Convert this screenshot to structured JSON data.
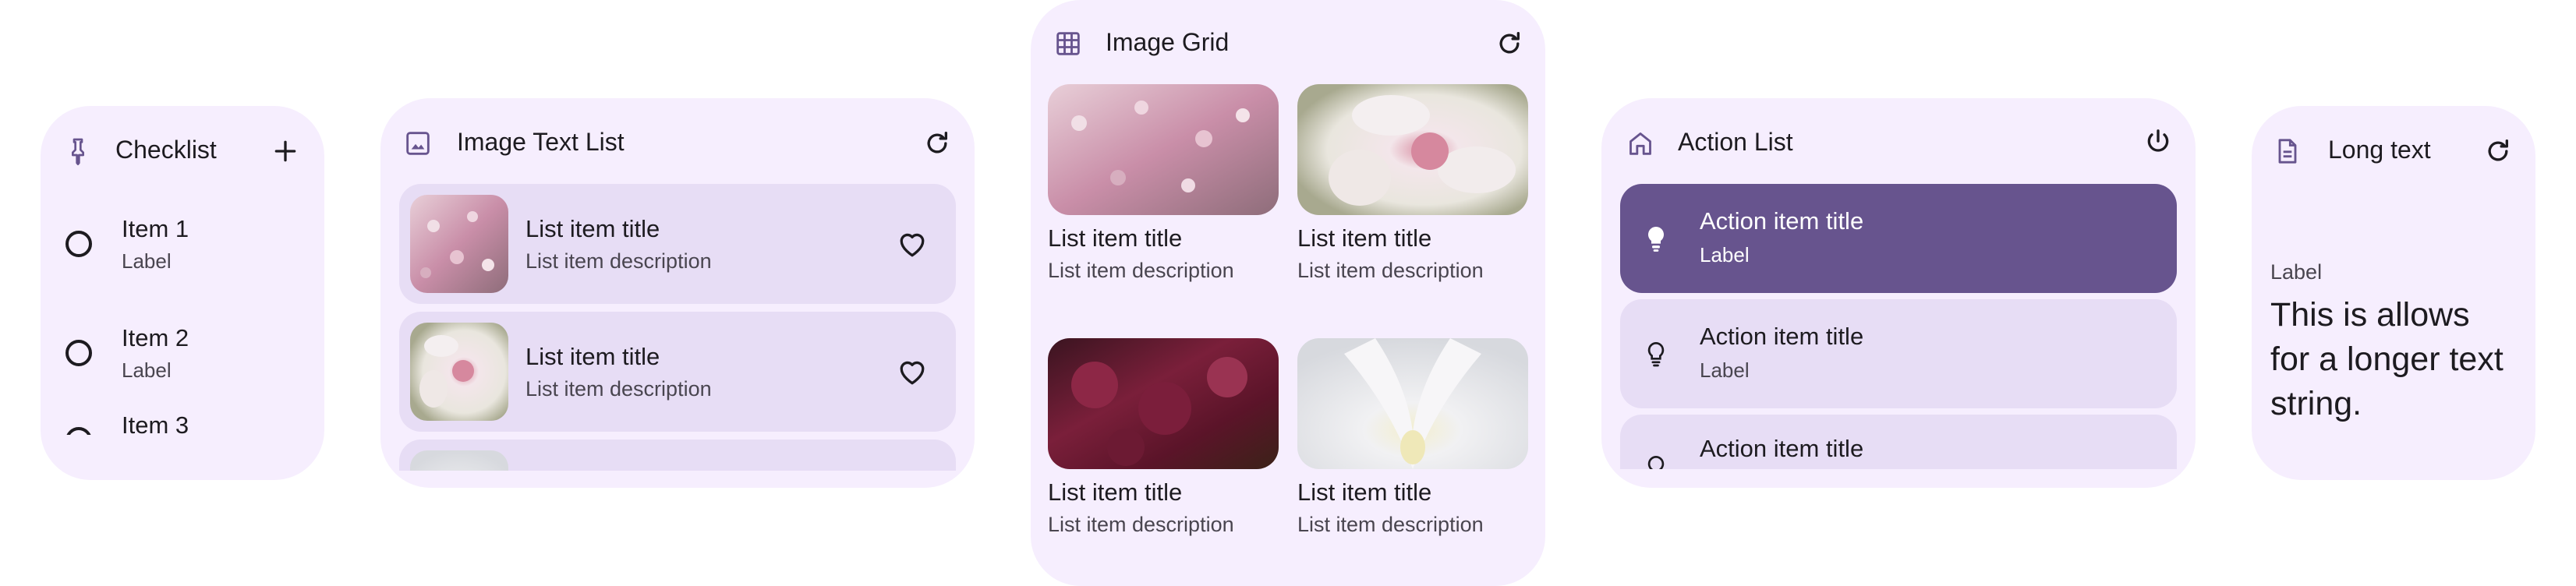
{
  "colors": {
    "widget_bg": "#f6eefe",
    "card_bg": "#e7ddf5",
    "active_card_bg": "#67548e",
    "icon_tint": "#67548e",
    "text_primary": "#1d1b20",
    "text_secondary": "#49454f"
  },
  "checklist": {
    "title": "Checklist",
    "header_icon": "pin-icon",
    "action_icon": "add-icon",
    "items": [
      {
        "title": "Item 1",
        "label": "Label"
      },
      {
        "title": "Item 2",
        "label": "Label"
      },
      {
        "title": "Item 3",
        "label": ""
      }
    ]
  },
  "image_text_list": {
    "title": "Image Text List",
    "header_icon": "image-icon",
    "action_icon": "refresh-icon",
    "items": [
      {
        "title": "List item title",
        "description": "List item description",
        "image": "pink-flowers-photo",
        "action_icon": "heart-icon"
      },
      {
        "title": "List item title",
        "description": "List item description",
        "image": "white-flower-photo",
        "action_icon": "heart-icon"
      }
    ]
  },
  "image_grid": {
    "title": "Image Grid",
    "header_icon": "grid-icon",
    "action_icon": "refresh-icon",
    "items": [
      {
        "title": "List item title",
        "description": "List item description",
        "image": "pink-flowers-photo"
      },
      {
        "title": "List item title",
        "description": "List item description",
        "image": "white-flower-photo"
      },
      {
        "title": "List item title",
        "description": "List item description",
        "image": "dark-red-flowers-photo"
      },
      {
        "title": "List item title",
        "description": "List item description",
        "image": "white-orchid-photo"
      }
    ]
  },
  "action_list": {
    "title": "Action List",
    "header_icon": "home-icon",
    "action_icon": "power-icon",
    "items": [
      {
        "title": "Action item title",
        "label": "Label",
        "icon": "lightbulb-icon",
        "active": true
      },
      {
        "title": "Action item title",
        "label": "Label",
        "icon": "lightbulb-outline-icon",
        "active": false
      },
      {
        "title": "Action item title",
        "label": "",
        "icon": "lightbulb-outline-icon",
        "active": false
      }
    ]
  },
  "long_text": {
    "title": "Long text",
    "header_icon": "document-icon",
    "action_icon": "refresh-icon",
    "label": "Label",
    "body": "This is allows for a longer text string."
  }
}
